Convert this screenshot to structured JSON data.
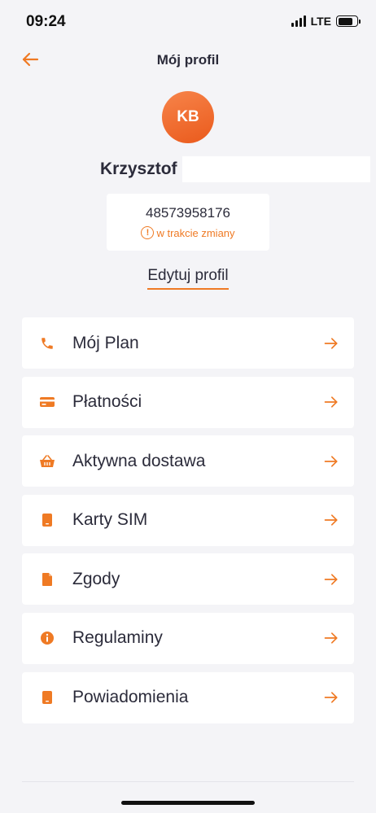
{
  "status_bar": {
    "time": "09:24",
    "network": "LTE"
  },
  "header": {
    "title": "Mój profil"
  },
  "profile": {
    "initials": "KB",
    "first_name": "Krzysztof",
    "phone": "48573958176",
    "phone_status": "w trakcie zmiany",
    "edit_label": "Edytuj profil"
  },
  "menu": [
    {
      "label": "Mój Plan",
      "icon": "phone-icon"
    },
    {
      "label": "Płatności",
      "icon": "credit-card-icon"
    },
    {
      "label": "Aktywna dostawa",
      "icon": "basket-icon"
    },
    {
      "label": "Karty SIM",
      "icon": "sim-card-icon"
    },
    {
      "label": "Zgody",
      "icon": "document-icon"
    },
    {
      "label": "Regulaminy",
      "icon": "info-icon"
    },
    {
      "label": "Powiadomienia",
      "icon": "phone-device-icon"
    }
  ],
  "colors": {
    "accent": "#ef7a24",
    "background": "#f4f4f7",
    "text": "#2b2b3a"
  }
}
